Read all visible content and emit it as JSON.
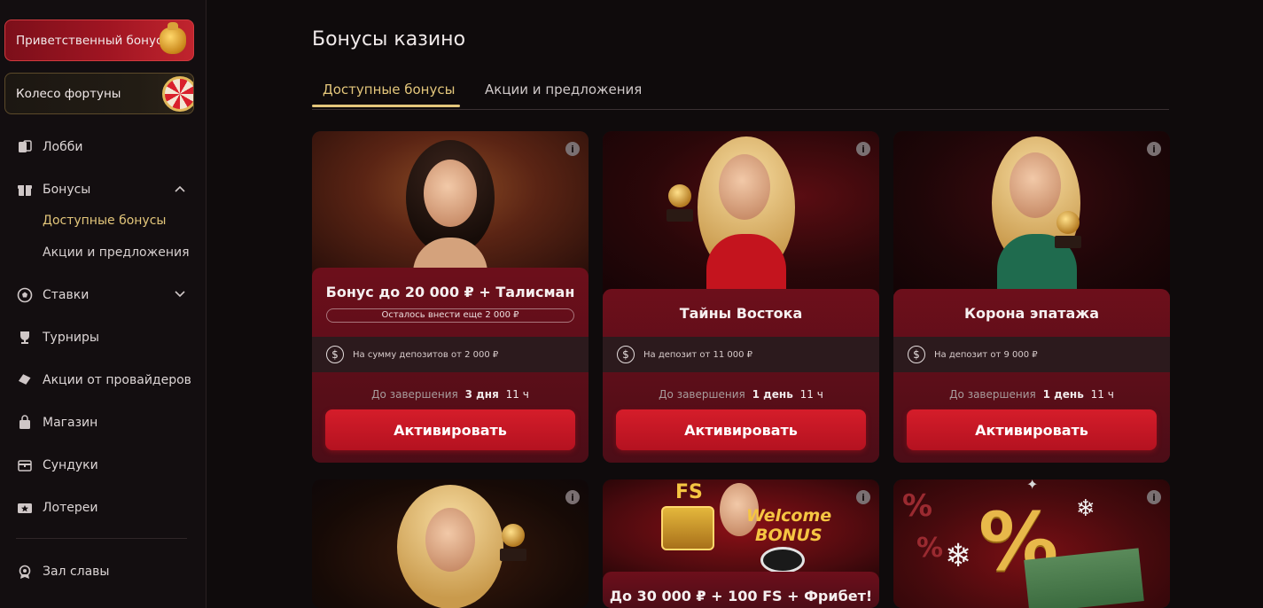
{
  "sidebar": {
    "promo_welcome": "Приветственный бонус",
    "promo_wheel": "Колесо фортуны",
    "items": {
      "lobby": "Лобби",
      "bonuses": "Бонусы",
      "available": "Доступные бонусы",
      "promotions": "Акции и предложения",
      "bets": "Ставки",
      "tournaments": "Турниры",
      "provider_promos": "Акции от провайдеров",
      "shop": "Магазин",
      "chests": "Сундуки",
      "lotteries": "Лотереи",
      "hall_of_fame": "Зал славы"
    }
  },
  "page": {
    "title": "Бонусы казино",
    "tabs": [
      "Доступные бонусы",
      "Акции и предложения"
    ],
    "active_tab": 0
  },
  "cards": [
    {
      "title": "Бонус до 20 000 ₽ + Талисман",
      "progress": "Осталось внести еще 2 000 ₽",
      "condition": "На сумму депозитов от 2 000 ₽",
      "timer_label": "До завершения",
      "timer_days": "3 дня",
      "timer_hours": "11 ч",
      "button": "Активировать"
    },
    {
      "title": "Тайны Востока",
      "condition": "На депозит от 11 000 ₽",
      "timer_label": "До завершения",
      "timer_days": "1 день",
      "timer_hours": "11 ч",
      "button": "Активировать"
    },
    {
      "title": "Корона эпатажа",
      "condition": "На депозит от 9 000 ₽",
      "timer_label": "До завершения",
      "timer_days": "1 день",
      "timer_hours": "11 ч",
      "button": "Активировать"
    },
    {
      "title": ""
    },
    {
      "title": "До 30 000 ₽ + 100 FS + Фрибет!",
      "banner_fs": "FS",
      "banner_welcome": "Welcome",
      "banner_bonus": "BONUS"
    },
    {
      "title": ""
    }
  ],
  "colors": {
    "accent_gold": "#e3c67b",
    "button_red": "#c8182a",
    "card_red": "#6d0f1b"
  }
}
